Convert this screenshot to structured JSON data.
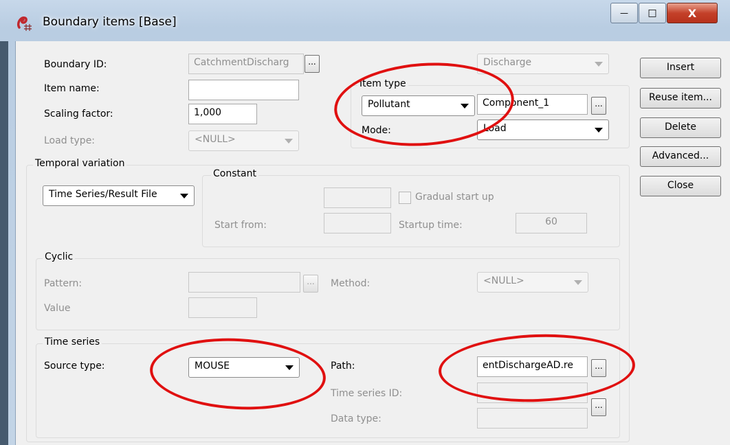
{
  "window": {
    "title": "Boundary items [Base]",
    "minimize_glyph": "—",
    "maximize_glyph": "□",
    "close_glyph": "X"
  },
  "boundary_id": {
    "label": "Boundary ID:",
    "value": "CatchmentDischarg"
  },
  "item_name": {
    "label": "Item name:",
    "value": ""
  },
  "scaling_factor": {
    "label": "Scaling factor:",
    "value": "1,000"
  },
  "load_type": {
    "label": "Load type:",
    "value": "<NULL>"
  },
  "discharge_combo": {
    "value": "Discharge"
  },
  "item_type": {
    "group_label": "Item type",
    "type_value": "Pollutant",
    "component_value": "Component_1",
    "mode_label": "Mode:",
    "mode_value": "Load"
  },
  "buttons": {
    "insert": "Insert",
    "reuse": "Reuse item...",
    "delete": "Delete",
    "advanced": "Advanced...",
    "close": "Close"
  },
  "temporal": {
    "group_label": "Temporal variation",
    "variation_value": "Time Series/Result File"
  },
  "constant": {
    "group_label": "Constant",
    "value": "",
    "gradual_label": "Gradual start up",
    "start_from_label": "Start from:",
    "start_from_value": "",
    "startup_time_label": "Startup time:",
    "startup_time_value": "60"
  },
  "cyclic": {
    "group_label": "Cyclic",
    "pattern_label": "Pattern:",
    "pattern_value": "",
    "method_label": "Method:",
    "method_value": "<NULL>",
    "value_label": "Value",
    "value_value": ""
  },
  "time_series": {
    "group_label": "Time series",
    "source_type_label": "Source type:",
    "source_type_value": "MOUSE",
    "path_label": "Path:",
    "path_value": "entDischargeAD.re",
    "ts_id_label": "Time series ID:",
    "ts_id_value": "",
    "data_type_label": "Data type:",
    "data_type_value": ""
  },
  "ellipsis_glyph": "...",
  "colors": {
    "annotation": "#e01010",
    "window_frame": "#c3d4e6",
    "client": "#f0f0f0"
  }
}
